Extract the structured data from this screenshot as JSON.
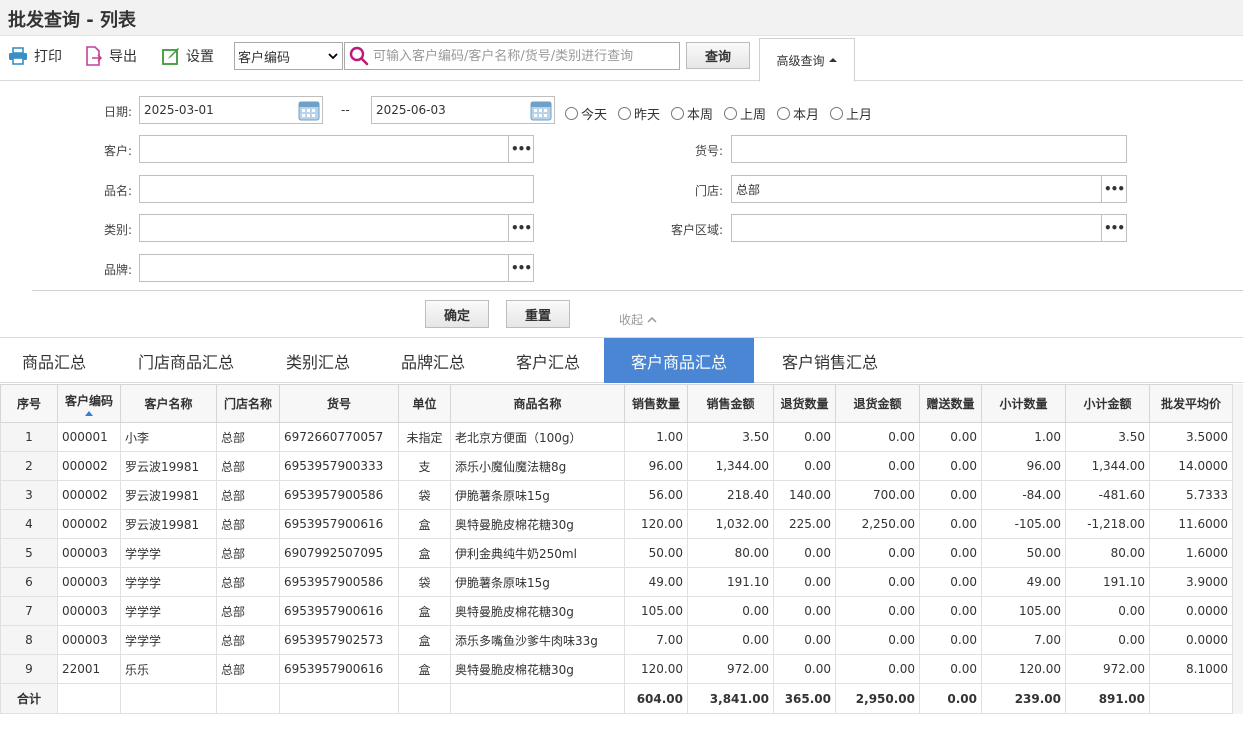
{
  "title": "批发查询 - 列表",
  "toolbar": {
    "print_label": "打印",
    "export_label": "导出",
    "settings_label": "设置",
    "search_field_selected": "客户编码",
    "search_placeholder": "可输入客户编码/客户名称/货号/类别进行查询",
    "query_label": "查询",
    "advanced_label": "高级查询"
  },
  "filters": {
    "date_label": "日期:",
    "date_from": "2025-03-01",
    "date_sep": "--",
    "date_to": "2025-06-03",
    "quick_dates": [
      "今天",
      "昨天",
      "本周",
      "上周",
      "本月",
      "上月"
    ],
    "customer_label": "客户:",
    "customer_value": "",
    "item_no_label": "货号:",
    "item_no_value": "",
    "product_name_label": "品名:",
    "product_name_value": "",
    "store_label": "门店:",
    "store_value": "总部",
    "category_label": "类别:",
    "category_value": "",
    "region_label": "客户区域:",
    "region_value": "",
    "brand_label": "品牌:",
    "brand_value": "",
    "confirm_label": "确定",
    "reset_label": "重置",
    "collapse_label": "收起"
  },
  "tabs": [
    "商品汇总",
    "门店商品汇总",
    "类别汇总",
    "品牌汇总",
    "客户汇总",
    "客户商品汇总",
    "客户销售汇总"
  ],
  "active_tab": "客户商品汇总",
  "table": {
    "columns": [
      "序号",
      "客户编码",
      "客户名称",
      "门店名称",
      "货号",
      "单位",
      "商品名称",
      "销售数量",
      "销售金额",
      "退货数量",
      "退货金额",
      "赠送数量",
      "小计数量",
      "小计金额",
      "批发平均价"
    ],
    "rows": [
      [
        "1",
        "000001",
        "小李",
        "总部",
        "6972660770057",
        "未指定",
        "老北京方便面（100g）",
        "1.00",
        "3.50",
        "0.00",
        "0.00",
        "0.00",
        "1.00",
        "3.50",
        "3.5000"
      ],
      [
        "2",
        "000002",
        "罗云波19981",
        "总部",
        "6953957900333",
        "支",
        "添乐小魔仙魔法糖8g",
        "96.00",
        "1,344.00",
        "0.00",
        "0.00",
        "0.00",
        "96.00",
        "1,344.00",
        "14.0000"
      ],
      [
        "3",
        "000002",
        "罗云波19981",
        "总部",
        "6953957900586",
        "袋",
        "伊脆薯条原味15g",
        "56.00",
        "218.40",
        "140.00",
        "700.00",
        "0.00",
        "-84.00",
        "-481.60",
        "5.7333"
      ],
      [
        "4",
        "000002",
        "罗云波19981",
        "总部",
        "6953957900616",
        "盒",
        "奥特曼脆皮棉花糖30g",
        "120.00",
        "1,032.00",
        "225.00",
        "2,250.00",
        "0.00",
        "-105.00",
        "-1,218.00",
        "11.6000"
      ],
      [
        "5",
        "000003",
        "学学学",
        "总部",
        "6907992507095",
        "盒",
        "伊利金典纯牛奶250ml",
        "50.00",
        "80.00",
        "0.00",
        "0.00",
        "0.00",
        "50.00",
        "80.00",
        "1.6000"
      ],
      [
        "6",
        "000003",
        "学学学",
        "总部",
        "6953957900586",
        "袋",
        "伊脆薯条原味15g",
        "49.00",
        "191.10",
        "0.00",
        "0.00",
        "0.00",
        "49.00",
        "191.10",
        "3.9000"
      ],
      [
        "7",
        "000003",
        "学学学",
        "总部",
        "6953957900616",
        "盒",
        "奥特曼脆皮棉花糖30g",
        "105.00",
        "0.00",
        "0.00",
        "0.00",
        "0.00",
        "105.00",
        "0.00",
        "0.0000"
      ],
      [
        "8",
        "000003",
        "学学学",
        "总部",
        "6953957902573",
        "盒",
        "添乐多嘴鱼沙爹牛肉味33g",
        "7.00",
        "0.00",
        "0.00",
        "0.00",
        "0.00",
        "7.00",
        "0.00",
        "0.0000"
      ],
      [
        "9",
        "22001",
        "乐乐",
        "总部",
        "6953957900616",
        "盒",
        "奥特曼脆皮棉花糖30g",
        "120.00",
        "972.00",
        "0.00",
        "0.00",
        "0.00",
        "120.00",
        "972.00",
        "8.1000"
      ]
    ],
    "total": {
      "label": "合计",
      "sales_qty": "604.00",
      "sales_amount": "3,841.00",
      "return_qty": "365.00",
      "return_amount": "2,950.00",
      "gift_qty": "0.00",
      "subtotal_qty": "239.00",
      "subtotal_amount": "891.00"
    }
  },
  "colors": {
    "accent": "#4a86d4",
    "search_icon": "#c0187a",
    "print_icon": "#3a8fc4",
    "export_icon": "#c4419a",
    "settings_icon": "#3a9a3a",
    "calendar_icon": "#6fa0c8"
  }
}
